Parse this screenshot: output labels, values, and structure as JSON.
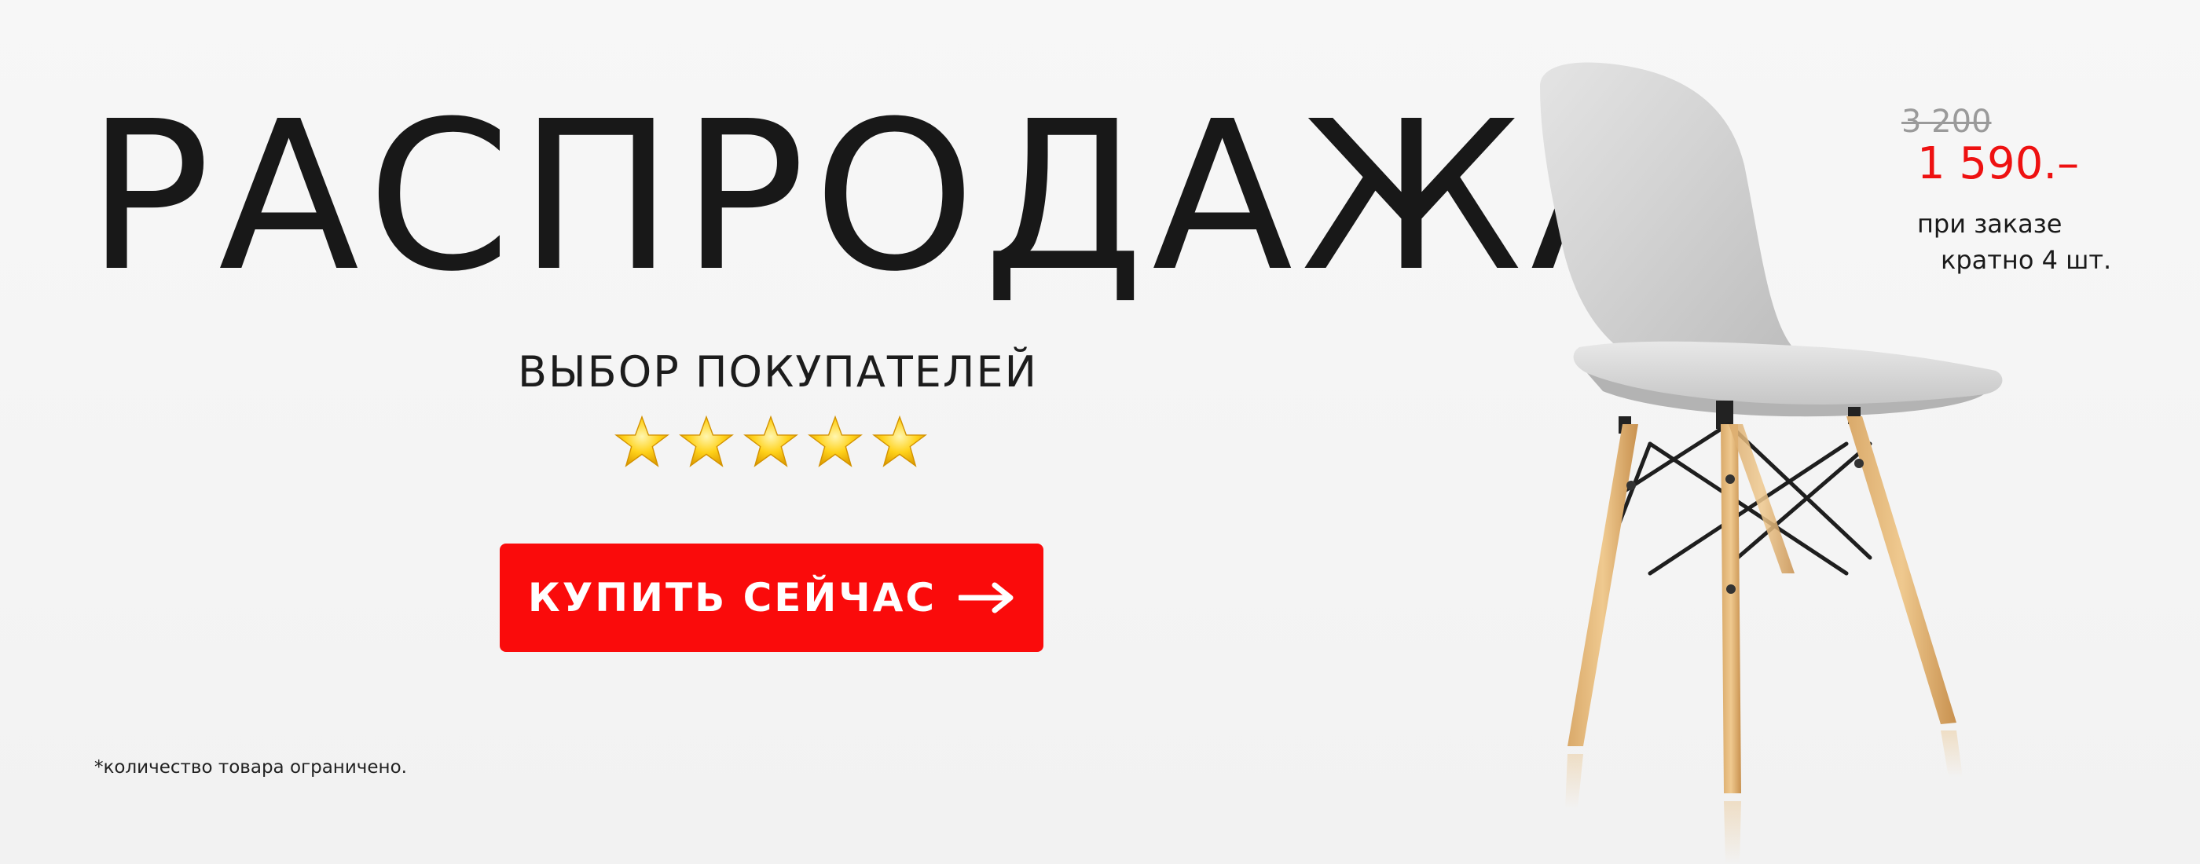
{
  "banner": {
    "headline": "РАСПРОДАЖА",
    "subtitle": "ВЫБОР ПОКУПАТЕЛЕЙ",
    "rating": {
      "value": 5,
      "max": 5,
      "icon": "star-icon",
      "color": "#ffcc00"
    },
    "cta": {
      "label": "КУПИТЬ СЕЙЧАС",
      "icon": "arrow-right-icon",
      "color": "#fa0b0b"
    },
    "disclaimer": "*количество товара ограничено."
  },
  "price": {
    "old": "3 200",
    "new": "1 590.–",
    "note_line1": "при заказе",
    "note_line2": "кратно 4 шт.",
    "accent_color": "#ee1111"
  },
  "product": {
    "image": "white-chair-wooden-legs"
  }
}
